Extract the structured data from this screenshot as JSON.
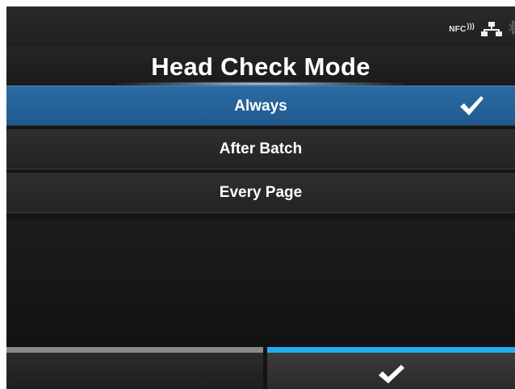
{
  "status_bar": {
    "nfc_label": "NFC",
    "icons": [
      "nfc-icon",
      "wired-network-icon",
      "bluetooth-icon"
    ]
  },
  "title": "Head Check Mode",
  "options": [
    {
      "label": "Always",
      "selected": true
    },
    {
      "label": "After Batch",
      "selected": false
    },
    {
      "label": "Every Page",
      "selected": false
    }
  ],
  "buttons": {
    "left": {
      "icon": "none"
    },
    "right": {
      "icon": "checkmark-icon"
    }
  },
  "colors": {
    "selected_row": "#2a6ba3",
    "ok_accent": "#21aef0",
    "back_accent": "#8a8a8a",
    "background": "#141414"
  }
}
